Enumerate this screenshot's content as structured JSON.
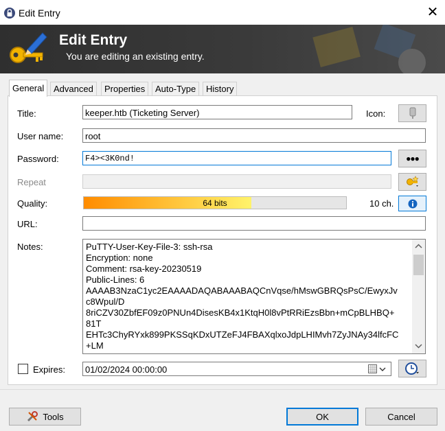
{
  "window": {
    "title": "Edit Entry",
    "close_glyph": "✕"
  },
  "banner": {
    "heading": "Edit Entry",
    "subheading": "You are editing an existing entry."
  },
  "tabs": [
    {
      "label": "General",
      "active": true
    },
    {
      "label": "Advanced"
    },
    {
      "label": "Properties"
    },
    {
      "label": "Auto-Type"
    },
    {
      "label": "History"
    }
  ],
  "form": {
    "title_label": "Title:",
    "title_value": "keeper.htb (Ticketing Server)",
    "icon_label": "Icon:",
    "username_label": "User name:",
    "username_value": "root",
    "password_label": "Password:",
    "password_value": "F4><3K0nd!",
    "password_toggle": "●●●",
    "repeat_label": "Repeat",
    "quality_label": "Quality:",
    "quality_text": "64 bits",
    "quality_fraction": 0.64,
    "char_count": "10 ch.",
    "url_label": "URL:",
    "url_value": "",
    "notes_label": "Notes:",
    "notes_lines": [
      "PuTTY-User-Key-File-3: ssh-rsa",
      "Encryption: none",
      "Comment: rsa-key-20230519",
      "Public-Lines: 6",
      "AAAAB3NzaC1yc2EAAAADAQABAAABAQCnVqse/hMswGBRQsPsC/EwyxJv",
      "c8Wpul/D",
      "8riCZV30ZbfEF09z0PNUn4DisesKB4x1KtqH0l8vPtRRiEzsBbn+mCpBLHBQ+",
      "81T",
      "EHTc3ChyRYxk899PKSSqKDxUTZeFJ4FBAXqlxoJdpLHIMvh7ZyJNAy34lfcFC",
      "+LM"
    ],
    "expires_label": "Expires:",
    "expires_checked": false,
    "expires_value": "01/02/2024 00:00:00"
  },
  "footer": {
    "tools_label": "Tools",
    "ok_label": "OK",
    "cancel_label": "Cancel"
  },
  "colors": {
    "accent": "#0078d7",
    "quality_start": "#ff8c00",
    "quality_end": "#fff36b"
  }
}
